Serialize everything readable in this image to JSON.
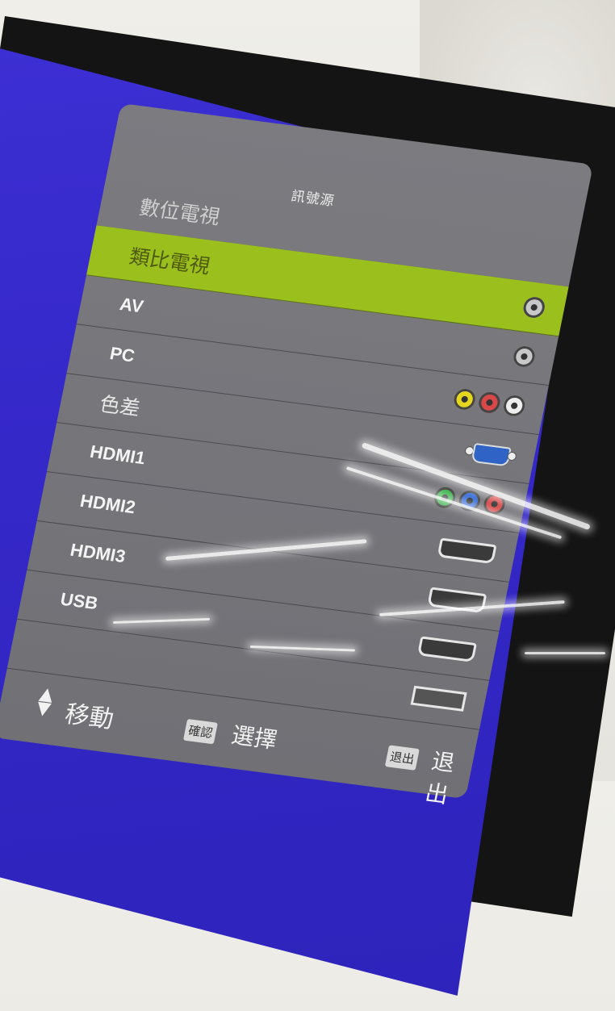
{
  "menu": {
    "title": "訊號源",
    "items": [
      {
        "label": "數位電視",
        "selected": false,
        "icon": "none"
      },
      {
        "label": "類比電視",
        "selected": true,
        "icon": "antenna-jack-icon"
      },
      {
        "label": "AV",
        "selected": false,
        "icon": "antenna-jack-icon"
      },
      {
        "label": "PC",
        "selected": false,
        "icon": "rca-composite-icon"
      },
      {
        "label": "色差",
        "selected": false,
        "icon": "vga-port-icon"
      },
      {
        "label": "HDMI1",
        "selected": false,
        "icon": "rca-component-icon"
      },
      {
        "label": "HDMI2",
        "selected": false,
        "icon": "hdmi-port-icon"
      },
      {
        "label": "HDMI3",
        "selected": false,
        "icon": "hdmi-port-icon"
      },
      {
        "label": "USB",
        "selected": false,
        "icon": "hdmi-port-icon"
      }
    ],
    "extra_icon": "usb-port-icon"
  },
  "footer": {
    "move_label": "移動",
    "confirm_key": "確認",
    "select_label": "選擇",
    "exit_key": "退出",
    "exit_label": "退出"
  },
  "colors": {
    "screen_blue": "#3528c9",
    "panel_grey": "#77777c",
    "highlight_green": "#9bbf1d"
  }
}
